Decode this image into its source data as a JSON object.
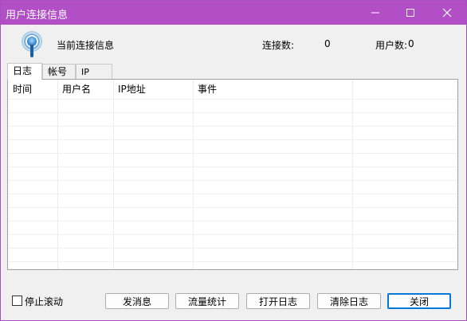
{
  "window": {
    "title": "用户连接信息",
    "accent": "#b24fc6"
  },
  "header": {
    "current_label": "当前连接信息",
    "connections_label": "连接数:",
    "connections_value": "0",
    "users_label": "用户数:",
    "users_value": "0"
  },
  "tabs": [
    {
      "label": "日志",
      "active": true
    },
    {
      "label": "帐号",
      "active": false
    },
    {
      "label": "IP",
      "active": false
    }
  ],
  "table": {
    "columns": [
      "时间",
      "用户名",
      "IP地址",
      "事件"
    ],
    "rows": []
  },
  "footer": {
    "stop_scroll_label": "停止滚动",
    "stop_scroll_checked": false,
    "buttons": {
      "send": "发消息",
      "stats": "流量统计",
      "open_log": "打开日志",
      "clear_log": "清除日志",
      "close": "关闭"
    }
  },
  "icons": {
    "signal": "wireless-signal-icon",
    "minimize": "minimize-icon",
    "maximize": "maximize-icon",
    "close": "close-icon"
  }
}
